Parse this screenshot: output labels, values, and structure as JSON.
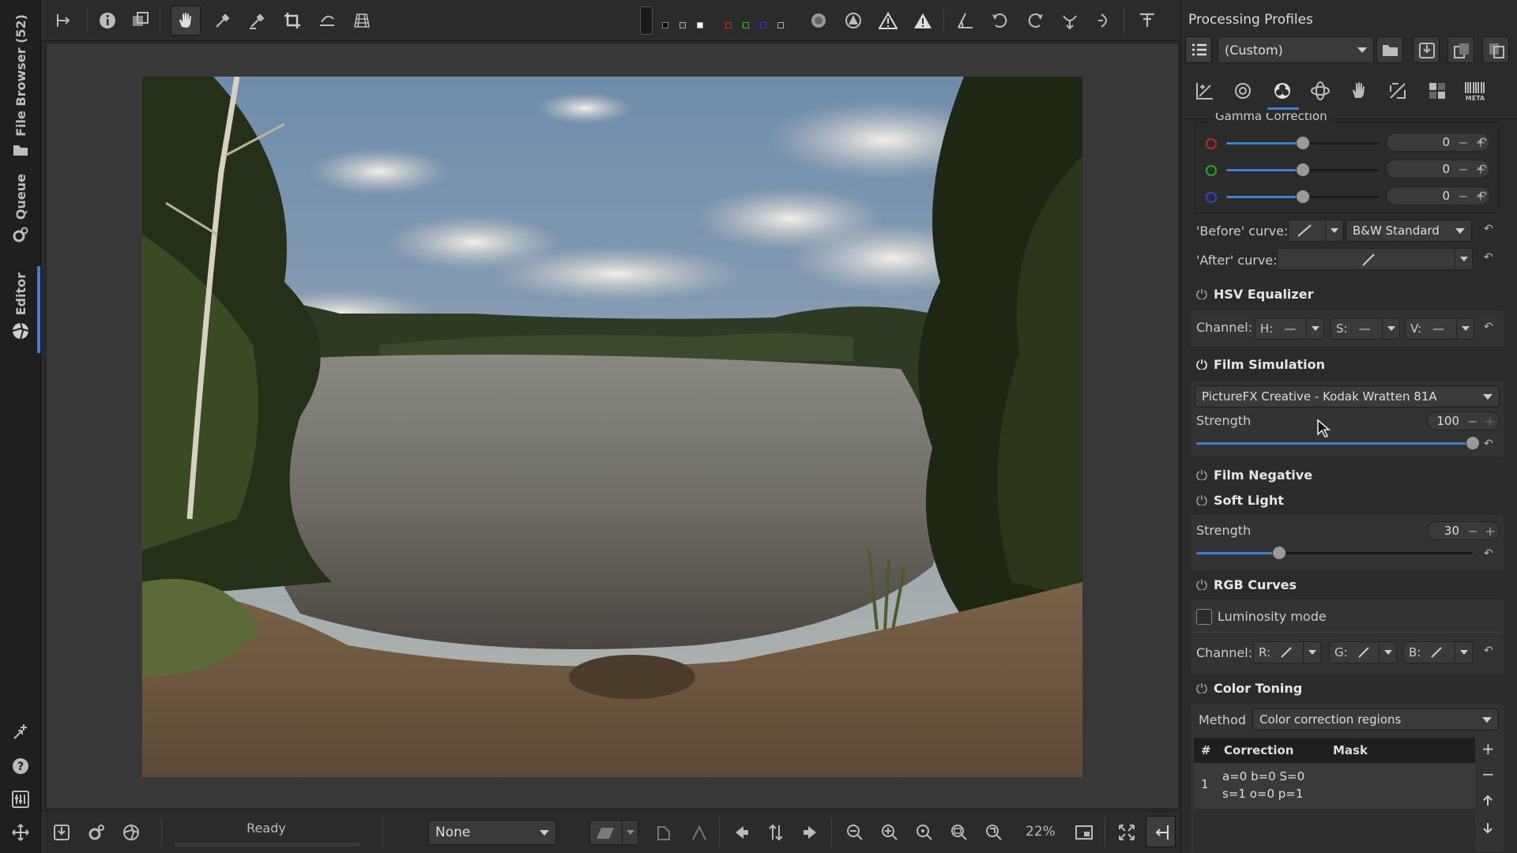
{
  "left_tabs": {
    "file_browser": "File Browser (52)",
    "queue": "Queue",
    "editor": "Editor"
  },
  "status": {
    "text": "Ready"
  },
  "bottom": {
    "profile_select": "None",
    "zoom": "22%"
  },
  "profiles": {
    "title": "Processing Profiles",
    "selected": "(Custom)"
  },
  "gamma": {
    "title": "Gamma Correction",
    "red": "0",
    "green": "0",
    "blue": "0",
    "before_curve_label": "'Before' curve:",
    "before_curve_value": "B&W Standard",
    "after_curve_label": "'After' curve:"
  },
  "hsv": {
    "title": "HSV Equalizer",
    "channel_label": "Channel:",
    "h": "H:",
    "s": "S:",
    "v": "V:"
  },
  "film_sim": {
    "title": "Film Simulation",
    "preset": "PictureFX Creative - Kodak Wratten 81A",
    "strength_label": "Strength",
    "strength_value": "100",
    "strength_level": 1.0
  },
  "film_negative": {
    "title": "Film Negative"
  },
  "soft_light": {
    "title": "Soft Light",
    "strength_label": "Strength",
    "strength_value": "30",
    "strength_level": 0.3
  },
  "rgb_curves": {
    "title": "RGB Curves",
    "luminosity_label": "Luminosity mode",
    "channel_label": "Channel:",
    "r": "R:",
    "g": "G:",
    "b": "B:"
  },
  "color_toning": {
    "title": "Color Toning",
    "method_label": "Method",
    "method_value": "Color correction regions",
    "col_num": "#",
    "col_correction": "Correction",
    "col_mask": "Mask",
    "row_num": "1",
    "row_correction_1": "a=0 b=0 S=0",
    "row_correction_2": "s=1 o=0 p=1"
  },
  "colors": {
    "accent": "#3f7fd6",
    "panel_bg": "#2b2b2b",
    "section_bg": "#333333"
  }
}
